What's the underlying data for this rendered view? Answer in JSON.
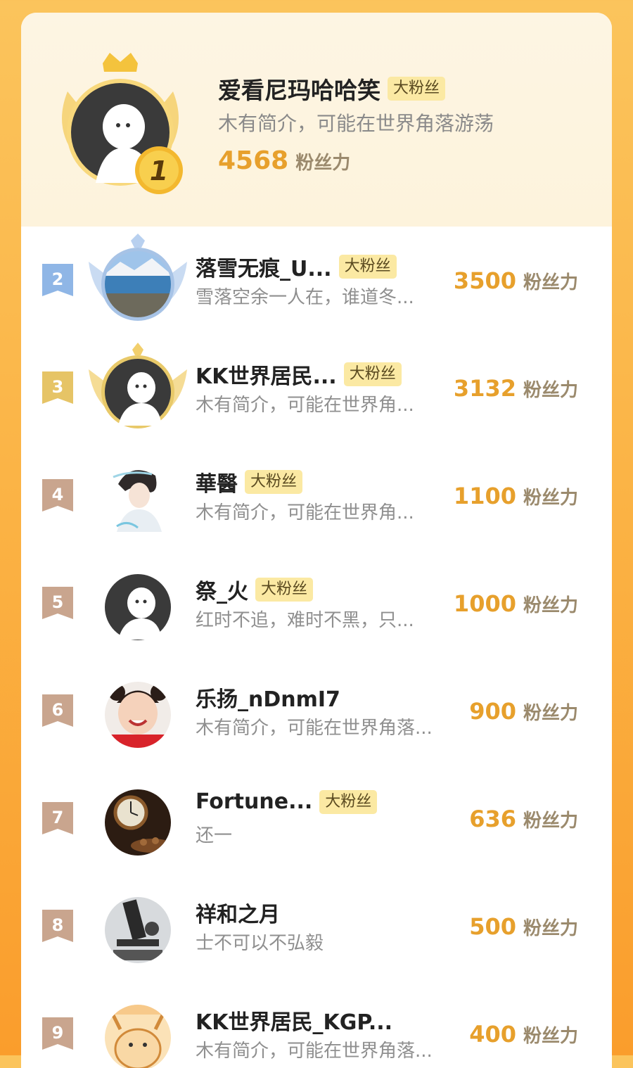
{
  "top": {
    "rank": "1",
    "name": "爱看尼玛哈哈笑",
    "tag": "大粉丝",
    "desc": "木有简介，可能在世界角落游荡",
    "power": "4568",
    "unit": "粉丝力"
  },
  "rows": [
    {
      "rank": "2",
      "name": "落雪无痕_U...",
      "tag": "大粉丝",
      "desc": "雪落空余一人在，谁道冬...",
      "power": "3500",
      "unit": "粉丝力",
      "avatar": "landscape-avatar"
    },
    {
      "rank": "3",
      "name": "KK世界居民...",
      "tag": "大粉丝",
      "desc": "木有简介，可能在世界角...",
      "power": "3132",
      "unit": "粉丝力",
      "avatar": "default-avatar"
    },
    {
      "rank": "4",
      "name": "華醫",
      "tag": "大粉丝",
      "desc": "木有简介，可能在世界角...",
      "power": "1100",
      "unit": "粉丝力",
      "avatar": "anime-avatar"
    },
    {
      "rank": "5",
      "name": "祭_火",
      "tag": "大粉丝",
      "desc": "红时不追，难时不黑，只...",
      "power": "1000",
      "unit": "粉丝力",
      "avatar": "default-avatar"
    },
    {
      "rank": "6",
      "name": "乐扬_nDnmI7",
      "tag": "",
      "desc": "木有简介，可能在世界角落...",
      "power": "900",
      "unit": "粉丝力",
      "avatar": "child-avatar"
    },
    {
      "rank": "7",
      "name": "Fortune...",
      "tag": "大粉丝",
      "desc": "还一",
      "power": "636",
      "unit": "粉丝力",
      "avatar": "clock-avatar"
    },
    {
      "rank": "8",
      "name": "祥和之月",
      "tag": "",
      "desc": "士不可以不弘毅",
      "power": "500",
      "unit": "粉丝力",
      "avatar": "microscope-avatar"
    },
    {
      "rank": "9",
      "name": "KK世界居民_KGP...",
      "tag": "",
      "desc": "木有简介，可能在世界角落...",
      "power": "400",
      "unit": "粉丝力",
      "avatar": "cartoon-avatar"
    }
  ],
  "colors": {
    "accent": "#e7a02c",
    "tag_bg": "#fbe9a3",
    "rank2": "#8fb6e6",
    "rank3": "#e6c466",
    "rank_other": "#c9a58e"
  }
}
